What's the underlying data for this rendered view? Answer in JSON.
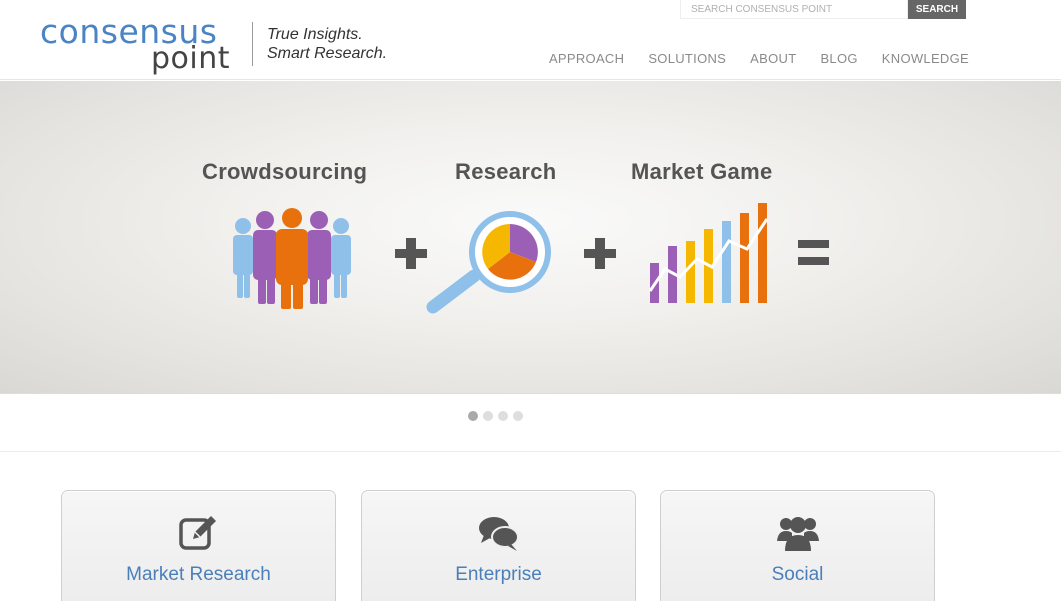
{
  "brand": {
    "logo_top": "consensus",
    "logo_bottom": "point",
    "tagline_line1": "True Insights.",
    "tagline_line2": "Smart Research."
  },
  "search": {
    "placeholder": "SEARCH CONSENSUS POINT",
    "button_label": "SEARCH"
  },
  "nav": {
    "items": [
      "APPROACH",
      "SOLUTIONS",
      "ABOUT",
      "BLOG",
      "KNOWLEDGE"
    ]
  },
  "hero": {
    "labels": [
      "Crowdsourcing",
      "Research",
      "Market Game"
    ],
    "colors": {
      "blue": "#8ec0ea",
      "purple": "#9b5fb5",
      "orange": "#e8710e",
      "yellow": "#f5b700",
      "operator": "#555555"
    }
  },
  "slider": {
    "total_slides": 4,
    "active_slide": 1
  },
  "cards": [
    {
      "title": "Market Research",
      "icon": "edit-icon"
    },
    {
      "title": "Enterprise",
      "icon": "chat-bubbles-icon"
    },
    {
      "title": "Social",
      "icon": "group-icon"
    }
  ],
  "theme": {
    "link_blue": "#4a7fba",
    "logo_blue": "#4a84c4"
  }
}
